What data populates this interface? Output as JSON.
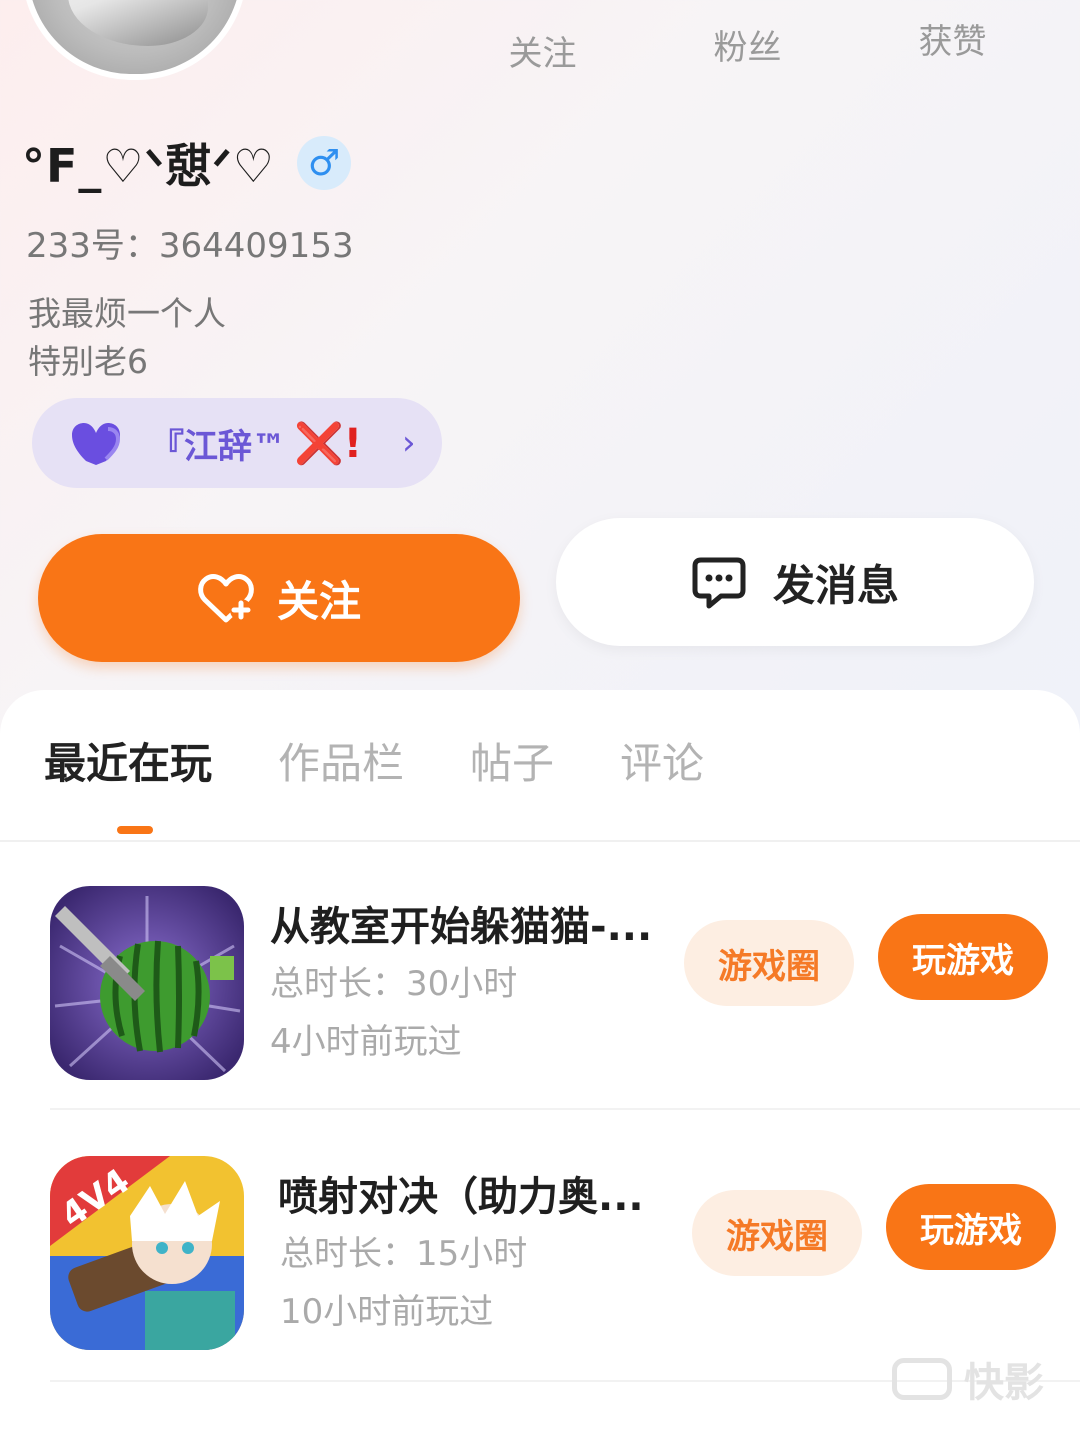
{
  "profile": {
    "nickname": "°F_♡ᐠ憇ᐟ♡",
    "gender_symbol": "♂",
    "uid": "233号：364409153",
    "bio_line1": "我最烦一个人",
    "bio_line2": "特别老6"
  },
  "stats": [
    {
      "label": "关注"
    },
    {
      "label": "粉丝"
    },
    {
      "label": "获赞"
    }
  ],
  "guild": {
    "name": "『江辞™",
    "x": "❌!",
    "chevron": "›"
  },
  "actions": {
    "follow": "关注",
    "message": "发消息"
  },
  "tabs": [
    "最近在玩",
    "作品栏",
    "帖子",
    "评论"
  ],
  "games": [
    {
      "title": "从教室开始躲猫猫-...",
      "total_time": "总时长：30小时",
      "last_played": "4小时前玩过",
      "circle_label": "游戏圈",
      "play_label": "玩游戏"
    },
    {
      "title": "喷射对决（助力奥...",
      "total_time": "总时长：15小时",
      "last_played": "10小时前玩过",
      "circle_label": "游戏圈",
      "play_label": "玩游戏"
    }
  ],
  "watermark": "快影",
  "colors": {
    "accent": "#f97516",
    "guild_text": "#6b57d6",
    "gender_blue": "#2e8ff0"
  }
}
